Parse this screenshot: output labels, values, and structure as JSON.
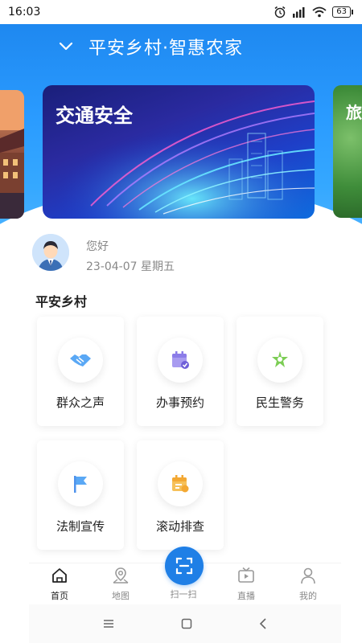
{
  "status_bar": {
    "time": "16:03",
    "battery": "63",
    "icons": [
      "alarm-icon",
      "signal-icon",
      "wifi-icon",
      "battery-icon"
    ]
  },
  "header": {
    "title": "平安乡村·智惠农家"
  },
  "banner": {
    "main_title": "交通安全",
    "next_label": "旅"
  },
  "greeting": {
    "hello": "您好",
    "date": "23-04-07 星期五"
  },
  "section": {
    "title": "平安乡村"
  },
  "tiles": [
    {
      "label": "群众之声",
      "icon": "handshake-icon"
    },
    {
      "label": "办事预约",
      "icon": "calendar-check-icon"
    },
    {
      "label": "民生警务",
      "icon": "police-service-icon"
    },
    {
      "label": "法制宣传",
      "icon": "flag-icon"
    },
    {
      "label": "滚动排查",
      "icon": "calendar-edit-icon"
    }
  ],
  "bottom_nav": {
    "items": [
      {
        "label": "首页",
        "icon": "home-icon",
        "active": true
      },
      {
        "label": "地图",
        "icon": "map-icon",
        "active": false
      },
      {
        "label": "扫一扫",
        "icon": "scan-icon",
        "active": false
      },
      {
        "label": "直播",
        "icon": "tv-icon",
        "active": false
      },
      {
        "label": "我的",
        "icon": "user-icon",
        "active": false
      }
    ]
  },
  "colors": {
    "primary": "#1f7fe6",
    "header_blue": "#2a9bff",
    "accent_orange": "#f3a833",
    "accent_purple": "#8b7ce8",
    "accent_green": "#6cc24a"
  }
}
